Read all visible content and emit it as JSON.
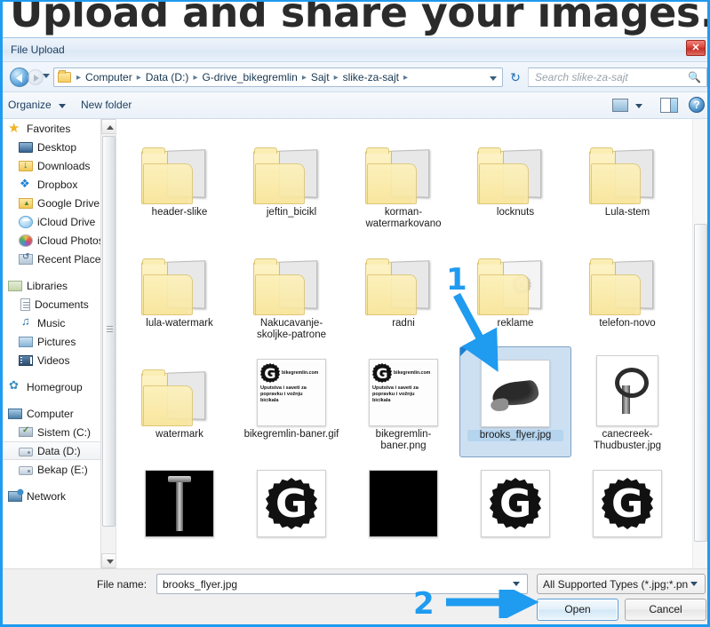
{
  "banner": {
    "text": "Upload and share your images."
  },
  "dialog": {
    "title": "File Upload",
    "close_label": "✕"
  },
  "addressbar": {
    "folder_icon": "folder-icon",
    "crumbs": [
      "Computer",
      "Data (D:)",
      "G-drive_bikegremlin",
      "Sajt",
      "slike-za-sajt"
    ],
    "separator": "▸",
    "dropdown_icon": "chevron-down-icon",
    "refresh_icon": "refresh-icon",
    "back_icon": "back-arrow-icon",
    "forward_icon": "forward-arrow-icon"
  },
  "search": {
    "placeholder": "Search slike-za-sajt",
    "icon": "search-icon"
  },
  "commandbar": {
    "organize": "Organize",
    "new_folder": "New folder",
    "view_icon": "view-icon",
    "preview_pane_icon": "preview-pane-icon",
    "help_icon": "help-icon",
    "help_glyph": "?"
  },
  "navpane": {
    "groups": [
      {
        "header": {
          "label": "Favorites",
          "icon": "favorites-star-icon",
          "icon_class": "ic-star"
        },
        "items": [
          {
            "label": "Desktop",
            "icon": "desktop-icon",
            "icon_class": "ic-desktop"
          },
          {
            "label": "Downloads",
            "icon": "downloads-folder-icon",
            "icon_class": "ic-folder ic-folder-dl"
          },
          {
            "label": "Dropbox",
            "icon": "dropbox-icon",
            "icon_class": "ic-dropbox"
          },
          {
            "label": "Google Drive",
            "icon": "google-drive-icon",
            "icon_class": "ic-gdrive"
          },
          {
            "label": "iCloud Drive",
            "icon": "icloud-drive-icon",
            "icon_class": "ic-icloud"
          },
          {
            "label": "iCloud Photos",
            "icon": "icloud-photos-icon",
            "icon_class": "ic-photos"
          },
          {
            "label": "Recent Places",
            "icon": "recent-places-icon",
            "icon_class": "ic-recent"
          }
        ]
      },
      {
        "header": {
          "label": "Libraries",
          "icon": "libraries-icon",
          "icon_class": "ic-libraries"
        },
        "items": [
          {
            "label": "Documents",
            "icon": "documents-icon",
            "icon_class": "ic-doc"
          },
          {
            "label": "Music",
            "icon": "music-icon",
            "icon_class": "ic-music"
          },
          {
            "label": "Pictures",
            "icon": "pictures-icon",
            "icon_class": "ic-pictures"
          },
          {
            "label": "Videos",
            "icon": "videos-icon",
            "icon_class": "ic-videos"
          }
        ]
      },
      {
        "header": {
          "label": "Homegroup",
          "icon": "homegroup-icon",
          "icon_class": "ic-homegroup"
        },
        "items": []
      },
      {
        "header": {
          "label": "Computer",
          "icon": "computer-icon",
          "icon_class": "ic-computer"
        },
        "items": [
          {
            "label": "Sistem (C:)",
            "icon": "system-drive-icon",
            "icon_class": "ic-sistem"
          },
          {
            "label": "Data (D:)",
            "icon": "drive-icon",
            "icon_class": "ic-drive",
            "selected": true
          },
          {
            "label": "Bekap (E:)",
            "icon": "drive-icon",
            "icon_class": "ic-drive"
          }
        ]
      },
      {
        "header": {
          "label": "Network",
          "icon": "network-icon",
          "icon_class": "ic-network"
        },
        "items": []
      }
    ]
  },
  "filelist": {
    "items": [
      {
        "name": "header-slike",
        "kind": "folder",
        "thumb": "tex-a"
      },
      {
        "name": "jeftin_bicikl",
        "kind": "folder",
        "thumb": "tex-b"
      },
      {
        "name": "korman-watermarkovano",
        "kind": "folder",
        "thumb": "tex-c"
      },
      {
        "name": "locknuts",
        "kind": "folder",
        "thumb": "tex-d"
      },
      {
        "name": "Lula-stem",
        "kind": "folder",
        "thumb": "tex-e"
      },
      {
        "name": "lula-watermark",
        "kind": "folder",
        "thumb": "tex-f"
      },
      {
        "name": "Nakucavanje-skoljke-patrone",
        "kind": "folder",
        "thumb": "tex-g"
      },
      {
        "name": "radni",
        "kind": "folder",
        "thumb": "tex-h"
      },
      {
        "name": "reklame",
        "kind": "folder",
        "thumb": "gear-gray"
      },
      {
        "name": "telefon-novo",
        "kind": "folder",
        "thumb": "tex-i"
      },
      {
        "name": "watermark",
        "kind": "folder",
        "thumb": "tex-j"
      },
      {
        "name": "bikegremlin-baner.gif",
        "kind": "image",
        "thumb": "gremlin-banner"
      },
      {
        "name": "bikegremlin-baner.png",
        "kind": "image",
        "thumb": "gremlin-banner"
      },
      {
        "name": "brooks_flyer.jpg",
        "kind": "image",
        "thumb": "saddle",
        "selected": true
      },
      {
        "name": "canecreek-Thudbuster.jpg",
        "kind": "image",
        "thumb": "clamp"
      },
      {
        "name": "",
        "kind": "image",
        "thumb": "seatpost-black"
      },
      {
        "name": "",
        "kind": "image",
        "thumb": "gear-big"
      },
      {
        "name": "",
        "kind": "image",
        "thumb": "black"
      },
      {
        "name": "",
        "kind": "image",
        "thumb": "gear-big"
      },
      {
        "name": "",
        "kind": "image",
        "thumb": "gear-big"
      }
    ],
    "gremlin_banner": {
      "site": "bikegremlin.com",
      "line1": "Uputstva i saveti za",
      "line2": "popravku i vožnju",
      "line3": "bicikala"
    }
  },
  "bottombar": {
    "filename_label": "File name:",
    "filename_value": "brooks_flyer.jpg",
    "filetype_value": "All Supported Types (*.jpg;*.pn",
    "open_label": "Open",
    "cancel_label": "Cancel"
  },
  "annotations": {
    "step1": "1",
    "step2": "2",
    "color": "#1f9bf0"
  }
}
